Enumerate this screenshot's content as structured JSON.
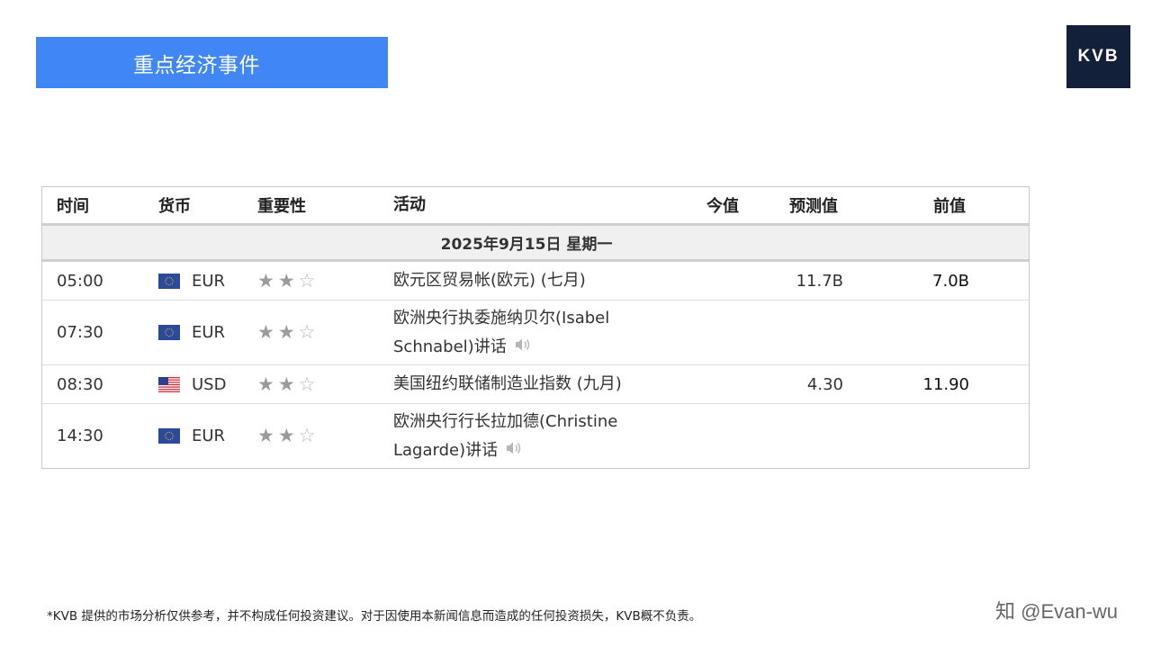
{
  "banner": {
    "title": "重点经济事件"
  },
  "logo": {
    "text": "KVB"
  },
  "colors": {
    "accent": "#4186f5",
    "logo_bg": "#132039"
  },
  "table": {
    "headers": {
      "time": "时间",
      "currency": "货币",
      "importance": "重要性",
      "activity": "活动",
      "actual": "今值",
      "forecast": "预测值",
      "previous": "前值"
    },
    "date": "2025年9月15日  星期一",
    "events": [
      {
        "time": "05:00",
        "flag": "eu-flag-icon",
        "currency": "EUR",
        "stars": 2,
        "max_stars": 3,
        "activity_line1": "欧元区贸易帐(欧元) (七月)",
        "activity_line2": "",
        "speech": false,
        "actual": "",
        "forecast": "11.7B",
        "previous": "7.0B"
      },
      {
        "time": "07:30",
        "flag": "eu-flag-icon",
        "currency": "EUR",
        "stars": 2,
        "max_stars": 3,
        "activity_line1": "欧洲央行执委施纳贝尔(Isabel",
        "activity_line2": "Schnabel)讲话",
        "speech": true,
        "actual": "",
        "forecast": "",
        "previous": ""
      },
      {
        "time": "08:30",
        "flag": "us-flag-icon",
        "currency": "USD",
        "stars": 2,
        "max_stars": 3,
        "activity_line1": "美国纽约联储制造业指数 (九月)",
        "activity_line2": "",
        "speech": false,
        "actual": "",
        "forecast": "4.30",
        "previous": "11.90"
      },
      {
        "time": "14:30",
        "flag": "eu-flag-icon",
        "currency": "EUR",
        "stars": 2,
        "max_stars": 3,
        "activity_line1": "欧洲央行行长拉加德(Christine",
        "activity_line2": "Lagarde)讲话",
        "speech": true,
        "actual": "",
        "forecast": "",
        "previous": ""
      }
    ]
  },
  "disclaimer": "*KVB 提供的市场分析仅供参考，并不构成任何投资建议。对于因使用本新闻信息而造成的任何投资损失，KVB概不负责。",
  "watermark": "知 @Evan-wu"
}
